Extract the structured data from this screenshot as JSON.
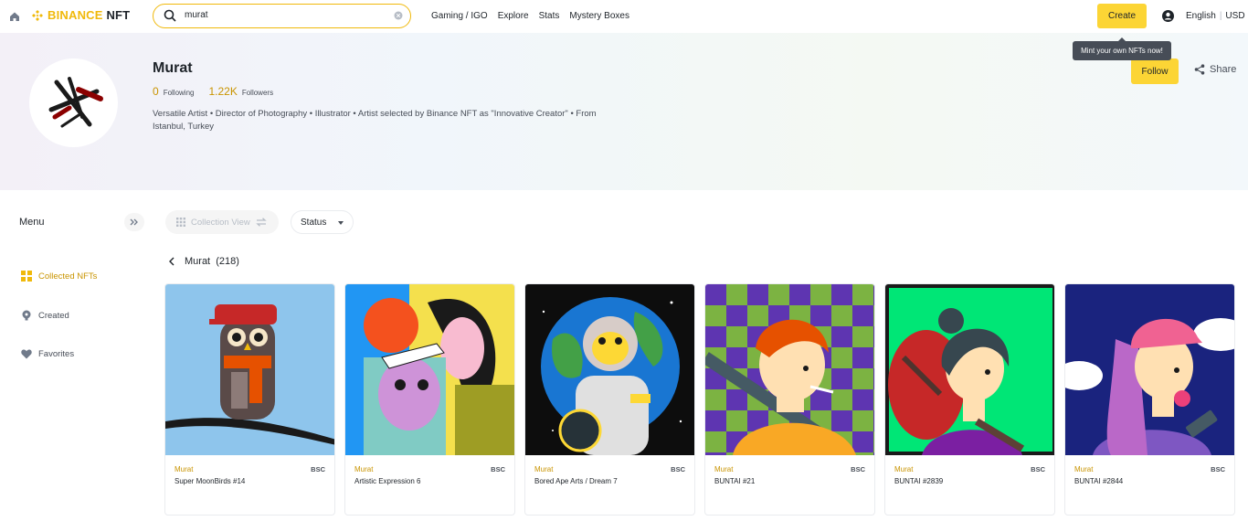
{
  "header": {
    "logo_brand": "BINANCE",
    "logo_product": "NFT",
    "search_value": "murat",
    "nav_items": [
      "Gaming / IGO",
      "Explore",
      "Stats",
      "Mystery Boxes"
    ],
    "create_label": "Create",
    "language": "English",
    "currency": "USD",
    "tooltip": "Mint your own NFTs now!"
  },
  "profile": {
    "name": "Murat",
    "following_count": "0",
    "following_label": "Following",
    "followers_count": "1.22K",
    "followers_label": "Followers",
    "bio": "Versatile Artist • Director of Photography • Illustrator • Artist selected by Binance NFT as \"Innovative Creator\" • From Istanbul, Turkey",
    "follow_label": "Follow",
    "share_label": "Share"
  },
  "sidebar": {
    "title": "Menu",
    "items": [
      {
        "label": "Collected NFTs",
        "icon": "grid-icon",
        "active": true
      },
      {
        "label": "Created",
        "icon": "brush-icon",
        "active": false
      },
      {
        "label": "Favorites",
        "icon": "heart-icon",
        "active": false
      }
    ]
  },
  "toolbar": {
    "view_label": "Collection View",
    "status_label": "Status"
  },
  "collection": {
    "name": "Murat",
    "count": "(218)"
  },
  "cards": [
    {
      "creator": "Murat",
      "chain": "BSC",
      "title": "Super MoonBirds #14"
    },
    {
      "creator": "Murat",
      "chain": "BSC",
      "title": "Artistic Expression 6"
    },
    {
      "creator": "Murat",
      "chain": "BSC",
      "title": "Bored Ape Arts / Dream 7"
    },
    {
      "creator": "Murat",
      "chain": "BSC",
      "title": "BUNTAI #21"
    },
    {
      "creator": "Murat",
      "chain": "BSC",
      "title": "BUNTAI #2839"
    },
    {
      "creator": "Murat",
      "chain": "BSC",
      "title": "BUNTAI #2844"
    }
  ],
  "colors": {
    "accent": "#F0B90B",
    "button": "#FCD535",
    "active_text": "#C99400"
  }
}
